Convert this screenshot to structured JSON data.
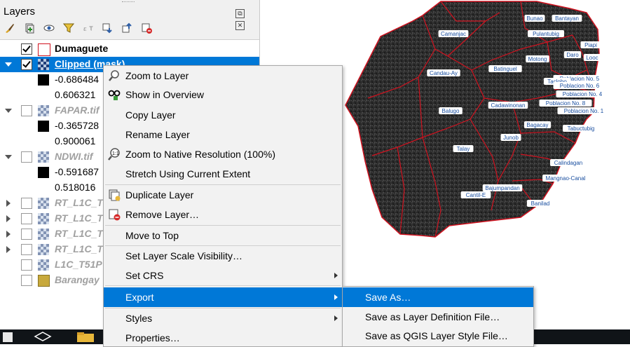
{
  "panel": {
    "title": "Layers",
    "float_btn": "⧉",
    "close_btn": "✕"
  },
  "layers": [
    {
      "name": "Dumaguete",
      "checked": true,
      "expanded": null,
      "style": "normal"
    },
    {
      "name": "Clipped (mask)",
      "checked": true,
      "expanded": true,
      "style": "normal",
      "selected": true,
      "min": "-0.686484",
      "max": "0.606321"
    },
    {
      "name": "FAPAR.tif",
      "checked": false,
      "expanded": true,
      "style": "italic",
      "min": "-0.365728",
      "max": "0.900061"
    },
    {
      "name": "NDWI.tif",
      "checked": false,
      "expanded": true,
      "style": "italic",
      "min": "-0.591687",
      "max": "0.518016"
    },
    {
      "name": "RT_L1C_T",
      "checked": false,
      "expanded": false,
      "style": "italic"
    },
    {
      "name": "RT_L1C_T",
      "checked": false,
      "expanded": false,
      "style": "italic"
    },
    {
      "name": "RT_L1C_T",
      "checked": false,
      "expanded": false,
      "style": "italic"
    },
    {
      "name": "RT_L1C_T",
      "checked": false,
      "expanded": false,
      "style": "italic"
    },
    {
      "name": "L1C_T51P",
      "checked": false,
      "expanded": null,
      "style": "italic"
    },
    {
      "name": "Barangay",
      "checked": false,
      "expanded": null,
      "style": "italic"
    }
  ],
  "context_menu": {
    "items": [
      {
        "label": "Zoom to Layer",
        "icon": "zoom-layer-icon",
        "accel": "Z"
      },
      {
        "label": "Show in Overview",
        "icon": "overview-icon",
        "accel": "S"
      },
      {
        "label": "Copy Layer",
        "icon": "",
        "accel": ""
      },
      {
        "label": "Rename Layer",
        "icon": "",
        "accel": ""
      },
      {
        "label": "Zoom to Native Resolution (100%)",
        "icon": "zoom-native-icon",
        "accel": ""
      },
      {
        "label": "Stretch Using Current Extent",
        "icon": "",
        "accel": "S"
      },
      {
        "label": "Duplicate Layer",
        "icon": "duplicate-icon",
        "accel": "D"
      },
      {
        "label": "Remove Layer…",
        "icon": "remove-icon",
        "accel": "R"
      },
      {
        "label": "Move to Top",
        "icon": "",
        "accel": "T"
      },
      {
        "label": "Set Layer Scale Visibility…",
        "icon": "",
        "accel": "S"
      },
      {
        "label": "Set CRS",
        "icon": "",
        "accel": "",
        "submenu": true
      },
      {
        "label": "Export",
        "icon": "",
        "accel": "",
        "submenu": true,
        "highlighted": true
      },
      {
        "label": "Styles",
        "icon": "",
        "accel": "",
        "submenu": true
      },
      {
        "label": "Properties…",
        "icon": "",
        "accel": "P"
      }
    ]
  },
  "export_submenu": {
    "items": [
      {
        "label": "Save As…",
        "highlighted": true
      },
      {
        "label": "Save as Layer Definition File…"
      },
      {
        "label": "Save as QGIS Layer Style File…"
      }
    ]
  },
  "map": {
    "labels": [
      "Bunao",
      "Bantayan",
      "Camanjac",
      "Pulantubig",
      "Piapi",
      "Motong",
      "Daro",
      "Looc",
      "Candau-Ay",
      "Batinguel",
      "Poblacion No. 5",
      "Taclobo",
      "Poblacion No. 6",
      "Poblacion No. 4",
      "Poblacion No. 8",
      "Poblacion No. 1",
      "Balugo",
      "Cadawinonan",
      "Bagacay",
      "Tabuctubig",
      "Junob",
      "Talay",
      "Calindagan",
      "Mangnao-Canal",
      "Bajumpandan",
      "Cantil-E",
      "Banilad"
    ],
    "boundary_color": "#d0121f"
  }
}
